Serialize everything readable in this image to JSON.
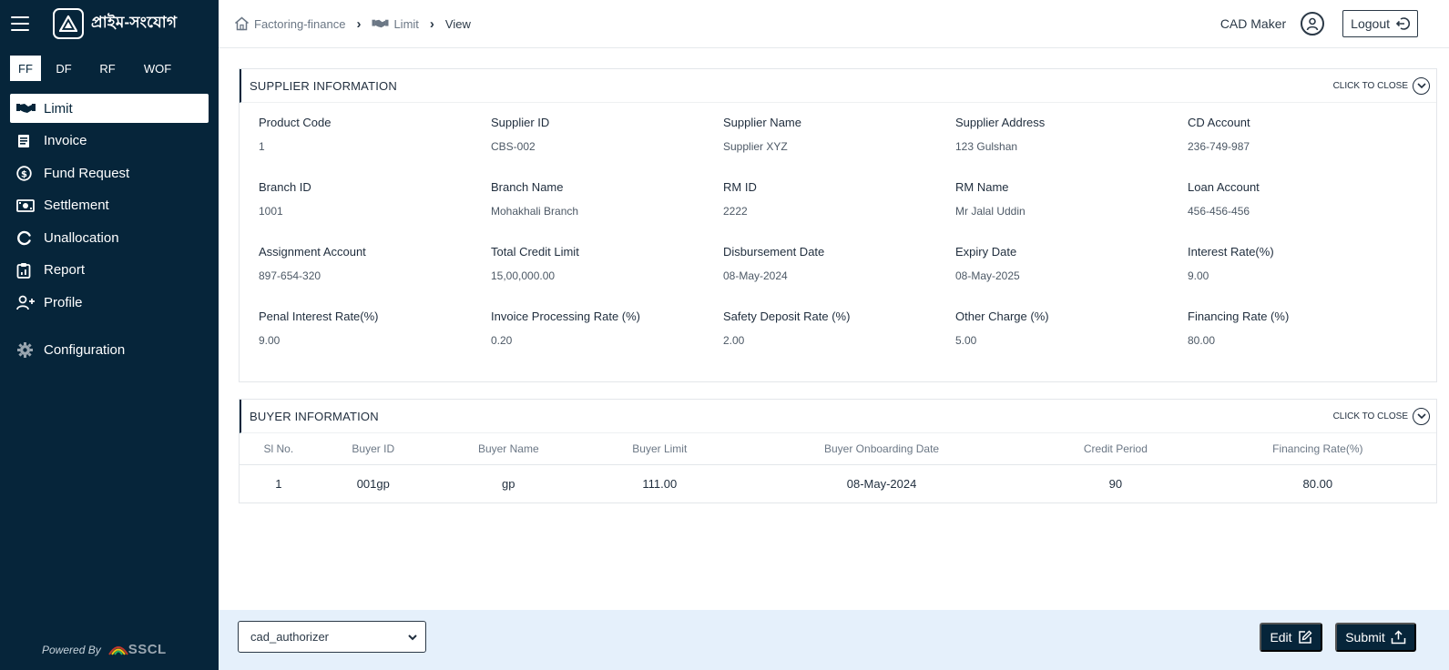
{
  "sidebar": {
    "brand": "প্রাইম-সংযোগ",
    "product_tabs": [
      {
        "label": "FF",
        "active": true
      },
      {
        "label": "DF",
        "active": false
      },
      {
        "label": "RF",
        "active": false
      },
      {
        "label": "WOF",
        "active": false
      }
    ],
    "menu": [
      {
        "label": "Limit",
        "icon": "handshake-icon",
        "active": true
      },
      {
        "label": "Invoice",
        "icon": "invoice-icon",
        "active": false
      },
      {
        "label": "Fund Request",
        "icon": "dollar-circle-icon",
        "active": false
      },
      {
        "label": "Settlement",
        "icon": "cash-icon",
        "active": false
      },
      {
        "label": "Unallocation",
        "icon": "circle-notch-icon",
        "active": false
      },
      {
        "label": "Report",
        "icon": "clipboard-icon",
        "active": false
      },
      {
        "label": "Profile",
        "icon": "user-plus-icon",
        "active": false
      },
      {
        "label": "Configuration",
        "icon": "gear-icon",
        "active": false
      }
    ],
    "powered_by": "Powered By",
    "powered_brand": "SSCL"
  },
  "breadcrumb": {
    "items": [
      "Factoring-finance",
      "Limit",
      "View"
    ]
  },
  "header": {
    "user_role": "CAD Maker",
    "logout_label": "Logout"
  },
  "supplier": {
    "title": "SUPPLIER INFORMATION",
    "toggle_label": "CLICK TO CLOSE",
    "fields": [
      {
        "label": "Product Code",
        "value": "1"
      },
      {
        "label": "Supplier ID",
        "value": "CBS-002"
      },
      {
        "label": "Supplier Name",
        "value": "Supplier XYZ"
      },
      {
        "label": "Supplier Address",
        "value": "123 Gulshan"
      },
      {
        "label": "CD Account",
        "value": "236-749-987"
      },
      {
        "label": "Branch ID",
        "value": "1001"
      },
      {
        "label": "Branch Name",
        "value": "Mohakhali Branch"
      },
      {
        "label": "RM ID",
        "value": "2222"
      },
      {
        "label": "RM Name",
        "value": "Mr Jalal Uddin"
      },
      {
        "label": "Loan Account",
        "value": "456-456-456"
      },
      {
        "label": "Assignment Account",
        "value": "897-654-320"
      },
      {
        "label": "Total Credit Limit",
        "value": "15,00,000.00"
      },
      {
        "label": "Disbursement Date",
        "value": "08-May-2024"
      },
      {
        "label": "Expiry Date",
        "value": "08-May-2025"
      },
      {
        "label": "Interest Rate(%)",
        "value": "9.00"
      },
      {
        "label": "Penal Interest Rate(%)",
        "value": "9.00"
      },
      {
        "label": "Invoice Processing Rate (%)",
        "value": "0.20"
      },
      {
        "label": "Safety Deposit Rate (%)",
        "value": "2.00"
      },
      {
        "label": "Other Charge (%)",
        "value": "5.00"
      },
      {
        "label": "Financing Rate (%)",
        "value": "80.00"
      }
    ]
  },
  "buyer": {
    "title": "BUYER INFORMATION",
    "toggle_label": "CLICK TO CLOSE",
    "columns": [
      "Sl No.",
      "Buyer ID",
      "Buyer Name",
      "Buyer Limit",
      "Buyer Onboarding Date",
      "Credit Period",
      "Financing Rate(%)"
    ],
    "rows": [
      [
        "1",
        "001gp",
        "gp",
        "111.00",
        "08-May-2024",
        "90",
        "80.00"
      ]
    ]
  },
  "footer": {
    "selected_user": "cad_authorizer",
    "edit_label": "Edit",
    "submit_label": "Submit"
  }
}
